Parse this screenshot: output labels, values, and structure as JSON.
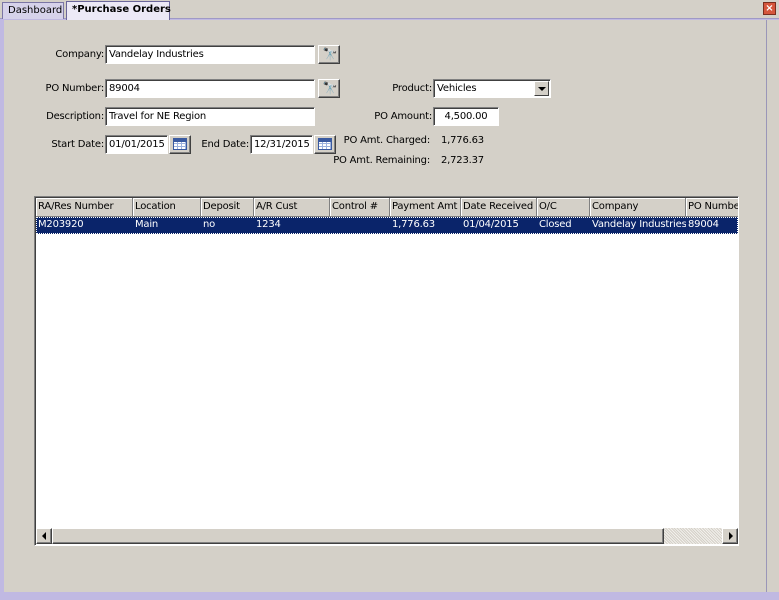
{
  "tabs": [
    {
      "label": "Dashboard",
      "active": false
    },
    {
      "label": "*Purchase Orders",
      "active": true
    }
  ],
  "close_glyph": "×",
  "form": {
    "company": {
      "label": "Company:",
      "value": "Vandelay Industries"
    },
    "po_number": {
      "label": "PO Number:",
      "value": "89004"
    },
    "description": {
      "label": "Description:",
      "value": "Travel for NE Region"
    },
    "start_date": {
      "label": "Start Date:",
      "value": "01/01/2015"
    },
    "end_date": {
      "label": "End Date:",
      "value": "12/31/2015"
    },
    "product": {
      "label": "Product:",
      "value": "Vehicles"
    },
    "po_amount": {
      "label": "PO Amount:",
      "value": "4,500.00"
    },
    "po_amt_charged": {
      "label": "PO Amt. Charged:",
      "value": "1,776.63"
    },
    "po_amt_remaining": {
      "label": "PO Amt. Remaining:",
      "value": "2,723.37"
    }
  },
  "grid": {
    "columns": [
      "RA/Res Number",
      "Location",
      "Deposit",
      "A/R Cust",
      "Control #",
      "Payment Amt",
      "Date Received",
      "O/C",
      "Company",
      "PO Number"
    ],
    "rows": [
      [
        "M203920",
        "Main",
        "no",
        "1234",
        "",
        "1,776.63",
        "01/04/2015",
        "Closed",
        "Vandelay Industries",
        "89004"
      ]
    ]
  },
  "colors": {
    "selection": "#0a246a",
    "panel": "#d4d0c8",
    "frame": "#c0b9e2"
  },
  "icons": {
    "search": "binoculars-icon",
    "calendar": "calendar-icon",
    "close": "close-icon"
  }
}
